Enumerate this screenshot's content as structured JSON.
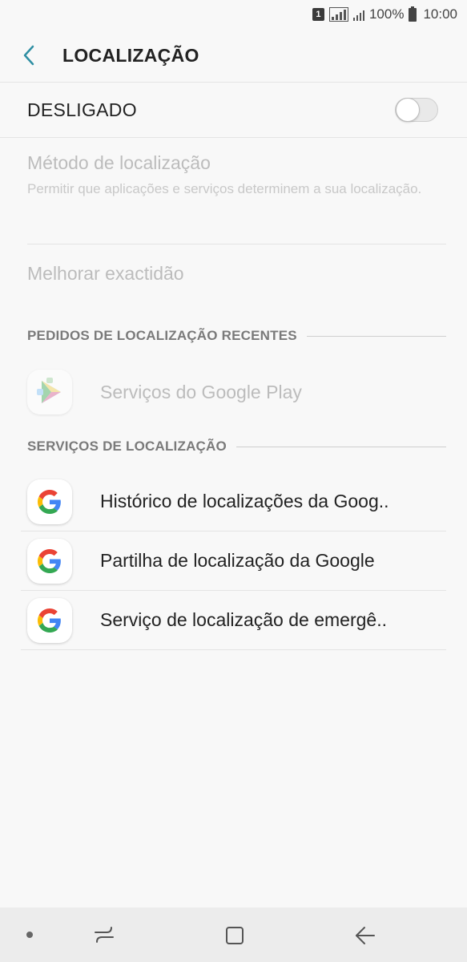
{
  "status_bar": {
    "sim": "1",
    "battery": "100%",
    "time": "10:00"
  },
  "header": {
    "title": "LOCALIZAÇÃO",
    "back_icon": "chevron-left-icon"
  },
  "master": {
    "label": "DESLIGADO",
    "toggle_on": false
  },
  "method": {
    "title": "Método de localização",
    "description": "Permitir que aplicações e serviços determinem a sua localização."
  },
  "accuracy": {
    "label": "Melhorar exactidão"
  },
  "recent_requests": {
    "header": "PEDIDOS DE LOCALIZAÇÃO RECENTES",
    "items": [
      {
        "label": "Serviços do Google Play",
        "icon": "google-play-services-icon"
      }
    ]
  },
  "location_services": {
    "header": "SERVIÇOS DE LOCALIZAÇÃO",
    "items": [
      {
        "label": "Histórico de localizações da Goog..",
        "icon": "google-icon"
      },
      {
        "label": "Partilha de localização da Google",
        "icon": "google-icon"
      },
      {
        "label": "Serviço de localização de emergê..",
        "icon": "google-icon"
      }
    ]
  },
  "nav_bar": {
    "dot_icon": "dot-icon",
    "recents_icon": "recents-icon",
    "home_icon": "home-icon",
    "back_icon": "back-arrow-icon"
  },
  "colors": {
    "accent": "#2f8fa3",
    "google_blue": "#4285F4",
    "google_red": "#EA4335",
    "google_yellow": "#FBBC05",
    "google_green": "#34A853"
  }
}
